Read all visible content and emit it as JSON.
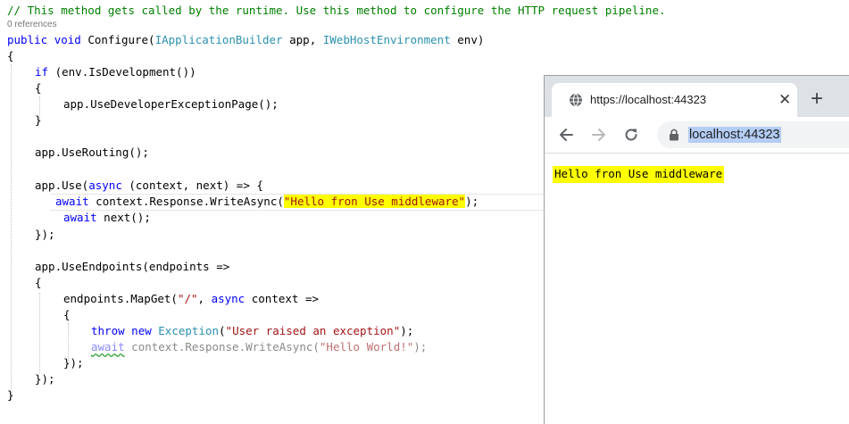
{
  "editor": {
    "comment_line": "// This method gets called by the runtime. Use this method to configure the HTTP request pipeline.",
    "references": "0 references",
    "sig": {
      "public": "public",
      "void": "void",
      "name": " Configure(",
      "type1": "IApplicationBuilder",
      "p1": " app, ",
      "type2": "IWebHostEnvironment",
      "p2": " env)"
    },
    "open_brace": "{",
    "if_kw": "if",
    "if_cond": " (env.IsDevelopment())",
    "brace_open_1": "{",
    "dev_page": "app.UseDeveloperExceptionPage();",
    "brace_close_1": "}",
    "use_routing": "app.UseRouting();",
    "use_pre": "app.Use(",
    "use_async": "async",
    "use_post": " (context, next) => {",
    "await1": "await",
    "write1_pre": " context.Response.WriteAsync(",
    "write1_str": "\"Hello fron Use middleware\"",
    "write1_post": ");",
    "await2": "await",
    "next_call": " next();",
    "use_close": "});",
    "endpoints_line": "app.UseEndpoints(endpoints =>",
    "brace_open_2": "{",
    "mapget_pre": "endpoints.MapGet(",
    "mapget_str": "\"/\"",
    "mapget_comma": ", ",
    "mapget_async": "async",
    "mapget_post": " context =>",
    "brace_open_3": "{",
    "throw_kw": "throw",
    "new_kw": "new",
    "exception_type": "Exception",
    "throw_paren": "(",
    "throw_str": "\"User raised an exception\"",
    "throw_post": ");",
    "await3": "await",
    "write2_pre": " context.Response.",
    "write2_method": "WriteAsync",
    "write2_paren": "(",
    "write2_str": "\"Hello World!\"",
    "write2_post": ");",
    "close_3": "});",
    "close_2": "});",
    "close_method": "}"
  },
  "browser": {
    "tab_title": "https://localhost:44323",
    "close_glyph": "✕",
    "new_tab_glyph": "+",
    "url": "localhost:44323",
    "page_text": "Hello fron Use middleware"
  },
  "colors": {
    "highlight": "#ffff00",
    "keyword": "#0000ff",
    "type": "#2b91af",
    "string": "#a31515",
    "comment": "#008000",
    "url_selection": "#b4cdf4"
  }
}
